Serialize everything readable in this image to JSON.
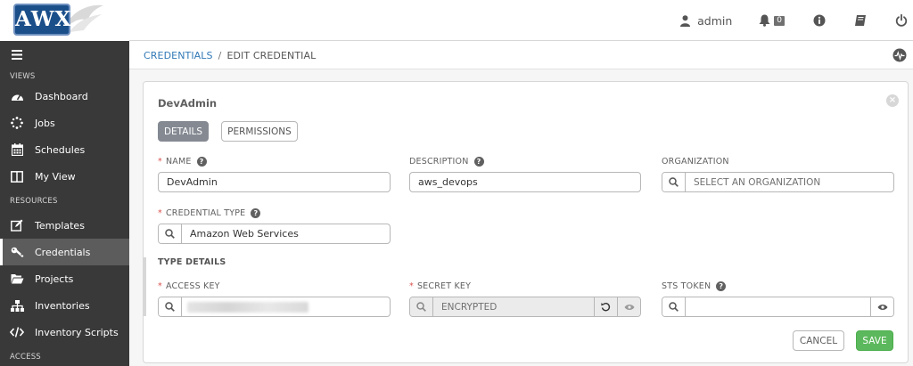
{
  "header": {
    "logo_text": "AWX",
    "username": "admin",
    "notification_count": "0",
    "icons": [
      "user-icon",
      "bell-icon",
      "info-icon",
      "book-icon",
      "power-icon"
    ]
  },
  "sidebar": {
    "sections": {
      "views": "VIEWS",
      "resources": "RESOURCES",
      "access": "ACCESS"
    },
    "items": [
      {
        "label": "Dashboard",
        "icon": "tachometer-icon"
      },
      {
        "label": "Jobs",
        "icon": "spinner-icon"
      },
      {
        "label": "Schedules",
        "icon": "calendar-icon"
      },
      {
        "label": "My View",
        "icon": "columns-icon"
      },
      {
        "label": "Templates",
        "icon": "pencil-square-icon"
      },
      {
        "label": "Credentials",
        "icon": "key-icon",
        "active": true
      },
      {
        "label": "Projects",
        "icon": "folder-open-icon"
      },
      {
        "label": "Inventories",
        "icon": "sitemap-icon"
      },
      {
        "label": "Inventory Scripts",
        "icon": "code-icon"
      }
    ]
  },
  "breadcrumb": {
    "parent": "CREDENTIALS",
    "separator": "/",
    "current": "EDIT CREDENTIAL"
  },
  "form": {
    "title": "DevAdmin",
    "tabs": {
      "details": "DETAILS",
      "permissions": "PERMISSIONS"
    },
    "name": {
      "label": "NAME",
      "value": "DevAdmin"
    },
    "description": {
      "label": "DESCRIPTION",
      "value": "aws_devops"
    },
    "organization": {
      "label": "ORGANIZATION",
      "placeholder": "SELECT AN ORGANIZATION"
    },
    "credential_type": {
      "label": "CREDENTIAL TYPE",
      "value": "Amazon Web Services"
    },
    "type_details_title": "TYPE DETAILS",
    "access_key": {
      "label": "ACCESS KEY"
    },
    "secret_key": {
      "label": "SECRET KEY",
      "value": "ENCRYPTED"
    },
    "sts_token": {
      "label": "STS TOKEN"
    },
    "buttons": {
      "cancel": "CANCEL",
      "save": "SAVE"
    }
  },
  "colors": {
    "sidebar_bg": "#393939",
    "link": "#337ab7",
    "save": "#5cb85c",
    "required": "#d9534f",
    "active_tab": "#848992"
  }
}
